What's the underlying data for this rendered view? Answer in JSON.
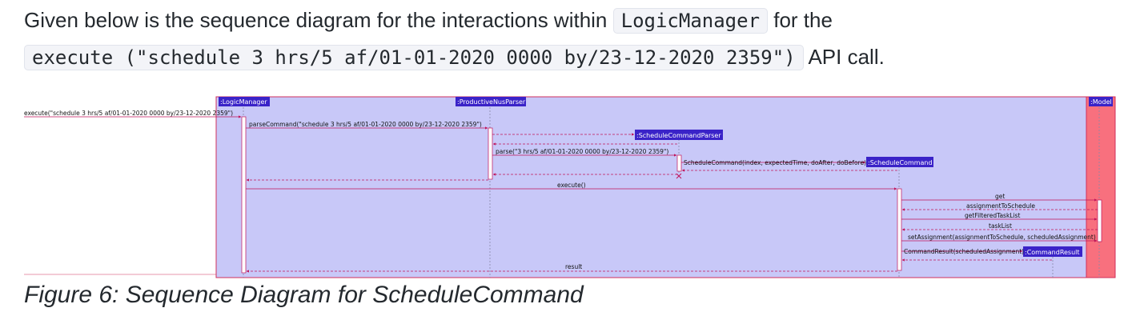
{
  "paragraph": {
    "text1": "Given below is the sequence diagram for the interactions within ",
    "code1": "LogicManager",
    "text2": " for the",
    "code2": "execute (\"schedule 3 hrs/5 af/01-01-2020 0000 by/23-12-2020 2359\")",
    "text3": " API call."
  },
  "diagram": {
    "colors": {
      "box": "#c8c8f8",
      "model": "#f8707e",
      "participant": "#3a23c8",
      "arrow": "#c0135a"
    },
    "participants": [
      ":LogicManager",
      ":ProductiveNusParser",
      ":ScheduleCommandParser",
      ":ScheduleCommand",
      ":CommandResult",
      ":Model"
    ],
    "messages": {
      "execute_call": "execute(\"schedule 3 hrs/5 af/01-01-2020 0000 by/23-12-2020 2359\")",
      "parse_command": "parseCommand(\"schedule 3 hrs/5 af/01-01-2020 0000 by/23-12-2020 2359\")",
      "parse": "parse(\"3 hrs/5 af/01-01-2020 0000 by/23-12-2020 2359\")",
      "schedule_command": "ScheduleCommand(index, expectedTime, doAfter, doBefore)",
      "execute": "execute()",
      "get": "get",
      "assignment_to_schedule": "assignmentToSchedule",
      "get_filtered": "getFilteredTaskList",
      "task_list": "taskList",
      "set_assignment": "setAssignment(assignmentToSchedule, scheduledAssignment)",
      "command_result": "CommandResult(scheduledAssignment)",
      "result": "result"
    }
  },
  "caption": "Figure 6: Sequence Diagram for ScheduleCommand"
}
